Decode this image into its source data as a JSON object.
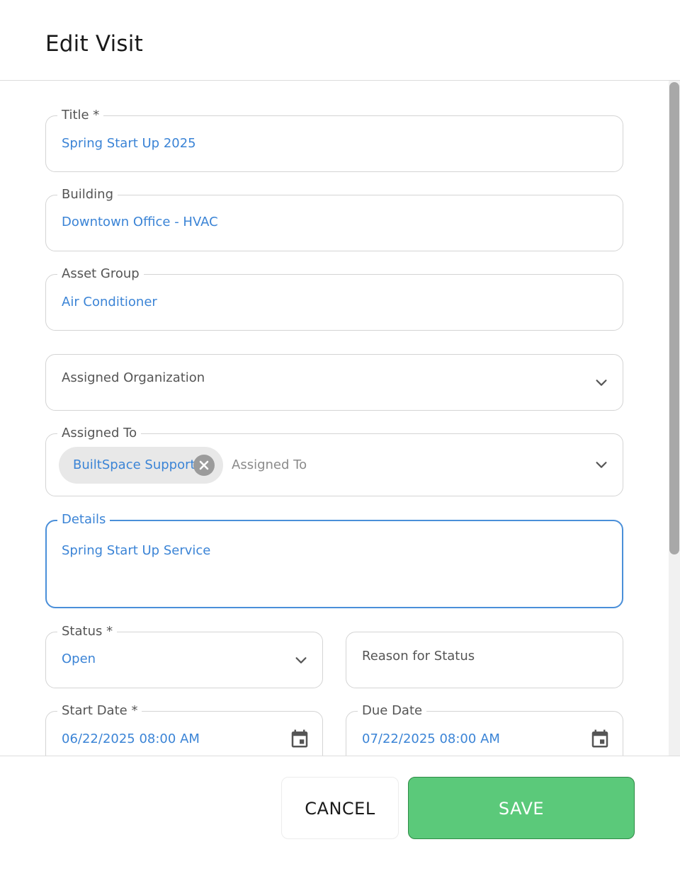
{
  "dialog": {
    "title": "Edit Visit"
  },
  "fields": {
    "title": {
      "label": "Title *",
      "value": "Spring Start Up 2025"
    },
    "building": {
      "label": "Building",
      "value": "Downtown Office - HVAC"
    },
    "asset_group": {
      "label": "Asset Group",
      "value": "Air Conditioner"
    },
    "assigned_organization": {
      "placeholder": "Assigned Organization"
    },
    "assigned_to": {
      "label": "Assigned To",
      "chip": "BuiltSpace Support",
      "placeholder": "Assigned To"
    },
    "details": {
      "label": "Details",
      "value": "Spring Start Up Service"
    },
    "status": {
      "label": "Status *",
      "value": "Open"
    },
    "reason_for_status": {
      "placeholder": "Reason for Status"
    },
    "start_date": {
      "label": "Start Date *",
      "value": "06/22/2025 08:00 AM"
    },
    "due_date": {
      "label": "Due Date",
      "value": "07/22/2025 08:00 AM"
    }
  },
  "footer": {
    "cancel_label": "CANCEL",
    "save_label": "SAVE"
  },
  "colors": {
    "accent": "#3b84d6",
    "save_button": "#5bc97a",
    "chip_background": "#e8e8e8"
  },
  "icons": {
    "dropdown": "chevron-down-icon",
    "date": "calendar-icon",
    "chip_remove": "close-circle-icon"
  }
}
